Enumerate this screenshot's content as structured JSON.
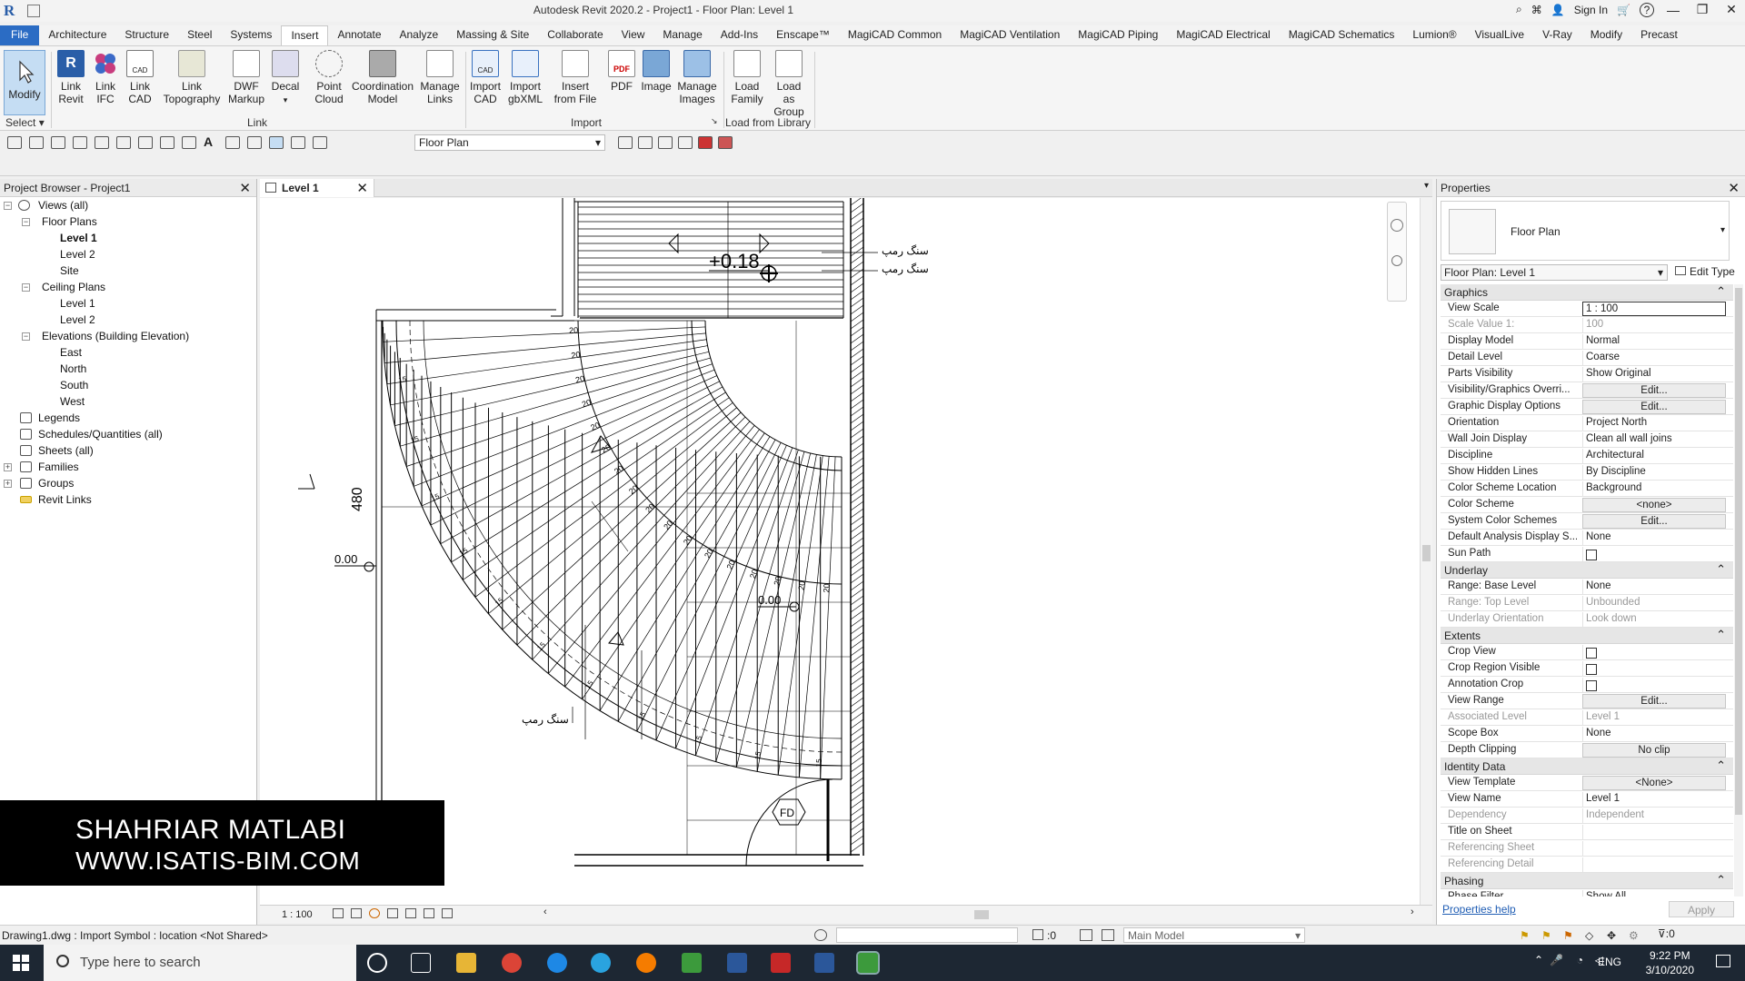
{
  "app": {
    "title": "Autodesk Revit 2020.2 - Project1 - Floor Plan: Level 1",
    "sign_in": "Sign In",
    "help": "?"
  },
  "tabs": [
    "File",
    "Architecture",
    "Structure",
    "Steel",
    "Systems",
    "Insert",
    "Annotate",
    "Analyze",
    "Massing & Site",
    "Collaborate",
    "View",
    "Manage",
    "Add-Ins",
    "Enscape™",
    "MagiCAD Common",
    "MagiCAD Ventilation",
    "MagiCAD Piping",
    "MagiCAD Electrical",
    "MagiCAD Schematics",
    "Lumion®",
    "VisualLive",
    "V-Ray",
    "Modify",
    "Precast"
  ],
  "ribbon": {
    "modify": "Modify",
    "select_label": "Select",
    "link_buttons": [
      "Link Revit",
      "Link IFC",
      "Link CAD",
      "Link Topography",
      "DWF Markup",
      "Decal",
      "Point Cloud",
      "Coordination Model",
      "Manage Links"
    ],
    "link_label": "Link",
    "import_buttons": [
      "Import CAD",
      "Import gbXML",
      "Insert from File",
      "PDF",
      "Image",
      "Manage Images"
    ],
    "import_label": "Import",
    "library_buttons": [
      "Load Family",
      "Load as Group"
    ],
    "library_label": "Load from Library"
  },
  "qat": {
    "type_dropdown": "Floor Plan"
  },
  "browser": {
    "title": "Project Browser - Project1",
    "items": {
      "views_all": "Views (all)",
      "floor_plans": "Floor Plans",
      "fp_level1": "Level 1",
      "fp_level2": "Level 2",
      "fp_site": "Site",
      "ceiling_plans": "Ceiling Plans",
      "cp_level1": "Level 1",
      "cp_level2": "Level 2",
      "elevations": "Elevations (Building Elevation)",
      "east": "East",
      "north": "North",
      "south": "South",
      "west": "West",
      "legends": "Legends",
      "schedules": "Schedules/Quantities (all)",
      "sheets": "Sheets (all)",
      "families": "Families",
      "groups": "Groups",
      "revit_links": "Revit Links"
    }
  },
  "watermark": {
    "name": "SHAHRIAR MATLABI",
    "url": "WWW.ISATIS-BIM.COM"
  },
  "view": {
    "tab_label": "Level 1",
    "scale": "1 : 100",
    "annotations": {
      "elev_top": "+0.18",
      "elev_left": "0.00",
      "elev_right": "0.00",
      "dim_480": "480",
      "label_ramp1": "سنگ رمپ",
      "label_ramp2": "سنگ رمپ",
      "label_ramp3": "سنگ رمپ",
      "fd": "FD",
      "step_20": "20",
      "step_15": "15"
    }
  },
  "properties": {
    "title": "Properties",
    "type_name": "Floor Plan",
    "instance": "Floor Plan: Level 1",
    "edit_type": "Edit Type",
    "groups": {
      "graphics": "Graphics",
      "underlay": "Underlay",
      "extents": "Extents",
      "identity": "Identity Data",
      "phasing": "Phasing"
    },
    "graphics_rows": [
      {
        "k": "View Scale",
        "v": "1 : 100"
      },
      {
        "k": "Scale Value    1:",
        "v": "100"
      },
      {
        "k": "Display Model",
        "v": "Normal"
      },
      {
        "k": "Detail Level",
        "v": "Coarse"
      },
      {
        "k": "Parts Visibility",
        "v": "Show Original"
      },
      {
        "k": "Visibility/Graphics Overri...",
        "v": "Edit..."
      },
      {
        "k": "Graphic Display Options",
        "v": "Edit..."
      },
      {
        "k": "Orientation",
        "v": "Project North"
      },
      {
        "k": "Wall Join Display",
        "v": "Clean all wall joins"
      },
      {
        "k": "Discipline",
        "v": "Architectural"
      },
      {
        "k": "Show Hidden Lines",
        "v": "By Discipline"
      },
      {
        "k": "Color Scheme Location",
        "v": "Background"
      },
      {
        "k": "Color Scheme",
        "v": "<none>"
      },
      {
        "k": "System Color Schemes",
        "v": "Edit..."
      },
      {
        "k": "Default Analysis Display S...",
        "v": "None"
      },
      {
        "k": "Sun Path",
        "v": ""
      }
    ],
    "underlay_rows": [
      {
        "k": "Range: Base Level",
        "v": "None"
      },
      {
        "k": "Range: Top Level",
        "v": "Unbounded"
      },
      {
        "k": "Underlay Orientation",
        "v": "Look down"
      }
    ],
    "extents_rows": [
      {
        "k": "Crop View",
        "v": ""
      },
      {
        "k": "Crop Region Visible",
        "v": ""
      },
      {
        "k": "Annotation Crop",
        "v": ""
      },
      {
        "k": "View Range",
        "v": "Edit..."
      },
      {
        "k": "Associated Level",
        "v": "Level 1"
      },
      {
        "k": "Scope Box",
        "v": "None"
      },
      {
        "k": "Depth Clipping",
        "v": "No clip"
      }
    ],
    "identity_rows": [
      {
        "k": "View Template",
        "v": "<None>"
      },
      {
        "k": "View Name",
        "v": "Level 1"
      },
      {
        "k": "Dependency",
        "v": "Independent"
      },
      {
        "k": "Title on Sheet",
        "v": ""
      },
      {
        "k": "Referencing Sheet",
        "v": ""
      },
      {
        "k": "Referencing Detail",
        "v": ""
      }
    ],
    "phasing_rows": [
      {
        "k": "Phase Filter",
        "v": "Show All"
      }
    ],
    "help": "Properties help",
    "apply": "Apply"
  },
  "status": {
    "message": "Drawing1.dwg : Import Symbol : location <Not Shared>",
    "workset_count": ":0",
    "model": "Main Model"
  },
  "taskbar": {
    "search_placeholder": "Type here to search",
    "lang": "ENG",
    "time": "9:22 PM",
    "date": "3/10/2020"
  }
}
